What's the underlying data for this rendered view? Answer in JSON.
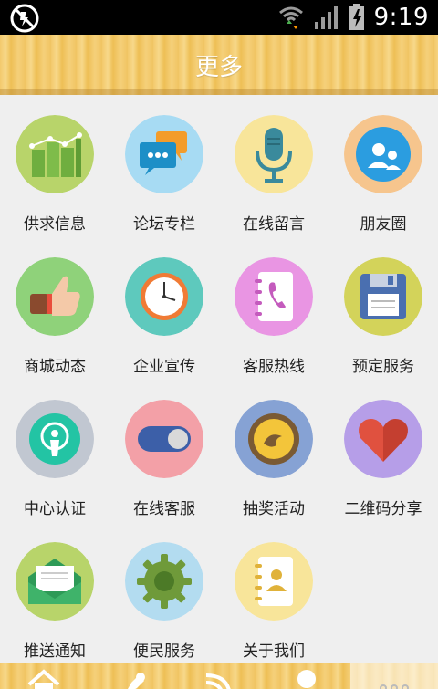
{
  "status_bar": {
    "time": "9:19"
  },
  "header": {
    "title": "更多"
  },
  "grid": {
    "items": [
      {
        "label": "供求信息",
        "icon": "bar-chart-icon",
        "bg": "#b8d46a"
      },
      {
        "label": "论坛专栏",
        "icon": "chat-bubbles-icon",
        "bg": "#a7dbf3"
      },
      {
        "label": "在线留言",
        "icon": "microphone-icon",
        "bg": "#f8e59a"
      },
      {
        "label": "朋友圈",
        "icon": "friends-icon",
        "bg": "#f6c58d"
      },
      {
        "label": "商城动态",
        "icon": "thumbs-up-icon",
        "bg": "#8fd27a"
      },
      {
        "label": "企业宣传",
        "icon": "clock-icon",
        "bg": "#5ec9bd"
      },
      {
        "label": "客服热线",
        "icon": "phone-book-icon",
        "bg": "#e995e3"
      },
      {
        "label": "预定服务",
        "icon": "floppy-disk-icon",
        "bg": "#d3d35a"
      },
      {
        "label": "中心认证",
        "icon": "certification-icon",
        "bg": "#c1c7d1"
      },
      {
        "label": "在线客服",
        "icon": "toggle-switch-icon",
        "bg": "#f3a0a7"
      },
      {
        "label": "抽奖活动",
        "icon": "lottery-coin-icon",
        "bg": "#86a2d4"
      },
      {
        "label": "二维码分享",
        "icon": "heart-icon",
        "bg": "#b69ee8"
      },
      {
        "label": "推送通知",
        "icon": "envelope-icon",
        "bg": "#b8d46a"
      },
      {
        "label": "便民服务",
        "icon": "gear-icon",
        "bg": "#b3dcf0"
      },
      {
        "label": "关于我们",
        "icon": "contacts-book-icon",
        "bg": "#f8e59a"
      }
    ]
  },
  "bottom_nav": {
    "items": [
      {
        "icon": "home-icon"
      },
      {
        "icon": "pin-icon"
      },
      {
        "icon": "rss-icon"
      },
      {
        "icon": "user-icon"
      },
      {
        "icon": "more-icon",
        "active": true
      }
    ]
  }
}
